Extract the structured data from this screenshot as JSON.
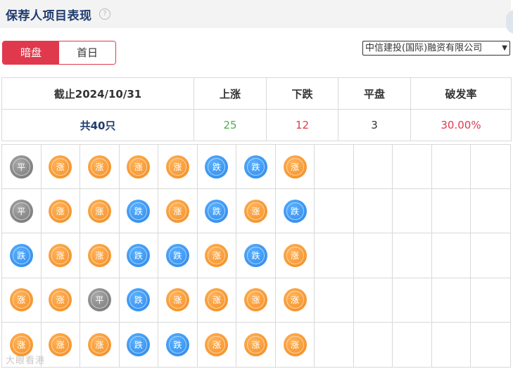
{
  "header": {
    "title": "保荐人项目表现",
    "help_glyph": "?"
  },
  "toggle": {
    "options": [
      "暗盘",
      "首日"
    ],
    "active": "暗盘"
  },
  "underwriter_select": {
    "selected": "中信建投(国际)融资有限公司"
  },
  "summary": {
    "headers": [
      "截止2024/10/31",
      "上涨",
      "下跌",
      "平盘",
      "破发率"
    ],
    "values": [
      "共40只",
      "25",
      "12",
      "3",
      "30.00%"
    ]
  },
  "coin_labels": {
    "rise": "涨",
    "fall": "跌",
    "flat": "平"
  },
  "coin_colors": {
    "rise": "#f28a1e",
    "fall": "#2b86e8",
    "flat": "#6f6f6f"
  },
  "stocks_grid": {
    "columns": 13,
    "rows": [
      [
        "flat",
        "rise",
        "rise",
        "rise",
        "rise",
        "fall",
        "fall",
        "rise"
      ],
      [
        "flat",
        "rise",
        "rise",
        "fall",
        "rise",
        "fall",
        "rise",
        "fall"
      ],
      [
        "fall",
        "rise",
        "rise",
        "fall",
        "fall",
        "rise",
        "fall",
        "rise"
      ],
      [
        "rise",
        "rise",
        "flat",
        "fall",
        "rise",
        "rise",
        "rise",
        "rise"
      ],
      [
        "rise",
        "rise",
        "rise",
        "fall",
        "fall",
        "rise",
        "rise",
        "rise"
      ]
    ]
  },
  "watermark": "大眼看港"
}
